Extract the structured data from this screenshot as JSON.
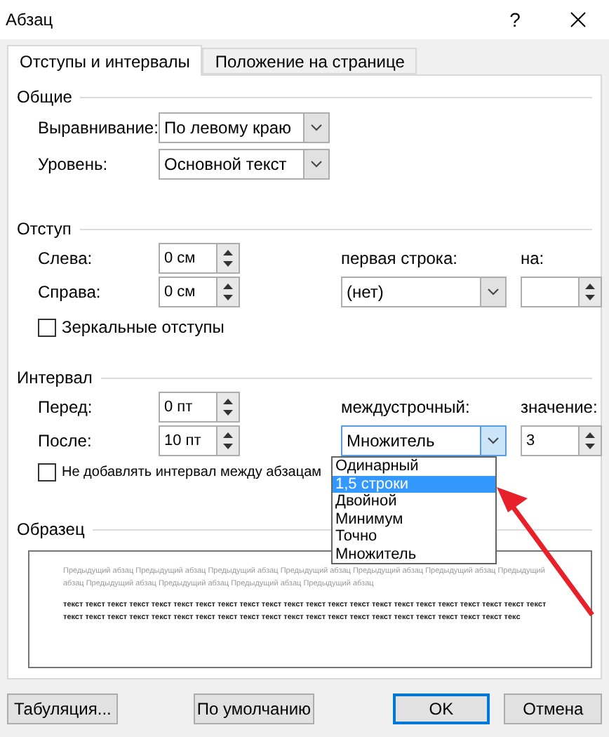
{
  "window": {
    "title": "Абзац",
    "help": "?"
  },
  "tabs": [
    {
      "label": "Отступы и интервалы",
      "selected": true
    },
    {
      "label": "Положение на странице",
      "selected": false
    }
  ],
  "general": {
    "title": "Общие",
    "fields": [
      {
        "label": "Выравнивание:",
        "value": "По левому краю"
      },
      {
        "label": "Уровень:",
        "value": "Основной текст"
      }
    ]
  },
  "indent": {
    "title": "Отступ",
    "left": {
      "label": "Слева:",
      "value": "0 см"
    },
    "right": {
      "label": "Справа:",
      "value": "0 см"
    },
    "first_line": {
      "label": "первая строка:",
      "value": "(нет)"
    },
    "by": {
      "label": "на:"
    },
    "mirror": {
      "label": "Зеркальные отступы",
      "checked": false
    }
  },
  "spacing": {
    "title": "Интервал",
    "before": {
      "label": "Перед:",
      "value": "0 пт"
    },
    "after": {
      "label": "После:",
      "value": "10 пт"
    },
    "line": {
      "label": "междустрочный:",
      "value": "Множитель",
      "open": true
    },
    "at": {
      "label": "значение:",
      "value": "3"
    },
    "no_space": {
      "label": "Не добавлять интервал между абзацам",
      "checked": false
    },
    "line_options": [
      {
        "label": "Одинарный",
        "selected": false
      },
      {
        "label": "1,5 строки",
        "selected": true
      },
      {
        "label": "Двойной",
        "selected": false
      },
      {
        "label": "Минимум",
        "selected": false
      },
      {
        "label": "Точно",
        "selected": false
      },
      {
        "label": "Множитель",
        "selected": false
      }
    ]
  },
  "preview": {
    "title": "Образец",
    "previous": "Предыдущий абзац Предыдущий абзац Предыдущий абзац Предыдущий абзац Предыдущий абзац Предыдущий абзац Предыдущий абзац Предыдущий абзац Предыдущий абзац Предыдущий абзац Предыдущий абзац",
    "sample": "текст текст текст текст текст текст текст текст текст текст текст текст текст текст текст текст текст текст текст текст текст текст текст текст текст текст текст текст текст текст текст текст текст текст текст текст текст текст текст текст текст текст текс"
  },
  "buttons": [
    {
      "label": "Табуляция...",
      "default": false
    },
    {
      "label": "По умолчанию",
      "default": false
    },
    {
      "label": "OK",
      "default": true
    },
    {
      "label": "Отмена",
      "default": false
    }
  ]
}
